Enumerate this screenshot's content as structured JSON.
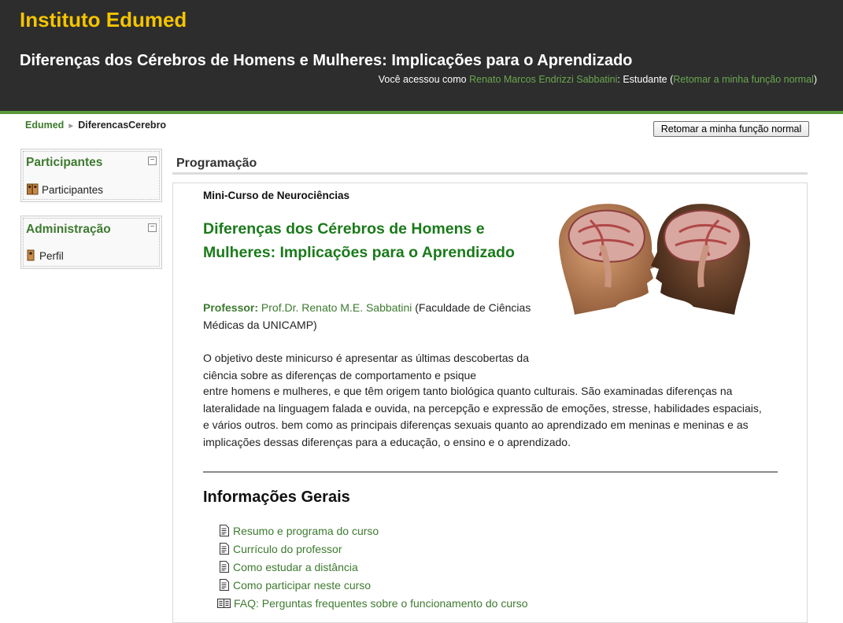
{
  "header": {
    "site_title": "Instituto Edumed",
    "course_title": "Diferenças dos Cérebros de Homens e Mulheres: Implicações para o Aprendizado",
    "login_prefix": "Você acessou como ",
    "user_name": "Renato Marcos Endrizzi Sabbatini",
    "role_text": ": Estudante (",
    "return_link": "Retomar a minha função normal",
    "close_paren": ")"
  },
  "breadcrumb": {
    "home": "Edumed",
    "separator": "►",
    "current": "DiferencasCerebro"
  },
  "return_button": "Retomar a minha função normal",
  "blocks": {
    "participants": {
      "title": "Participantes",
      "toggle": "−",
      "item": "Participantes"
    },
    "admin": {
      "title": "Administração",
      "toggle": "−",
      "item": "Perfil"
    }
  },
  "main": {
    "section_heading": "Programação",
    "course_subtitle": "Mini-Curso de Neurociências",
    "heading": "Diferenças dos Cérebros de Homens e Mulheres: Implicações para o Aprendizado",
    "professor_label": "Professor:",
    "professor_name": "Prof.Dr. Renato M.E. Sabbatini",
    "professor_affiliation": " (Faculdade de Ciências Médicas da UNICAMP)",
    "description_1": "O objetivo deste minicurso é apresentar as últimas descobertas da ciência sobre as diferenças de comportamento e psique",
    "description_2": "entre homens e mulheres, e que têm origem tanto biológica quanto culturais. São examinadas diferenças na lateralidade na linguagem falada e ouvida, na percepção e expressão de emoções, stresse, habilidades espaciais, e vários outros. bem como as principais diferenças sexuais quanto ao aprendizado em meninas e meninas e as implicações dessas diferenças para a educação, o ensino e o aprendizado.",
    "info_heading": "Informações Gerais",
    "resources": [
      {
        "label": "Resumo e programa do curso",
        "icon": "document-icon"
      },
      {
        "label": "Currículo do professor",
        "icon": "document-icon"
      },
      {
        "label": "Como estudar a distância",
        "icon": "document-icon"
      },
      {
        "label": "Como participar neste curso",
        "icon": "document-icon"
      },
      {
        "label": "FAQ: Perguntas frequentes sobre o funcionamento do curso",
        "icon": "glossary-icon"
      }
    ]
  },
  "colors": {
    "header_bg": "#2d2d2d",
    "site_title": "#f5c400",
    "accent_green": "#3d7a2f",
    "heading_green": "#1a7a1a",
    "header_border": "#5a9a3d"
  }
}
